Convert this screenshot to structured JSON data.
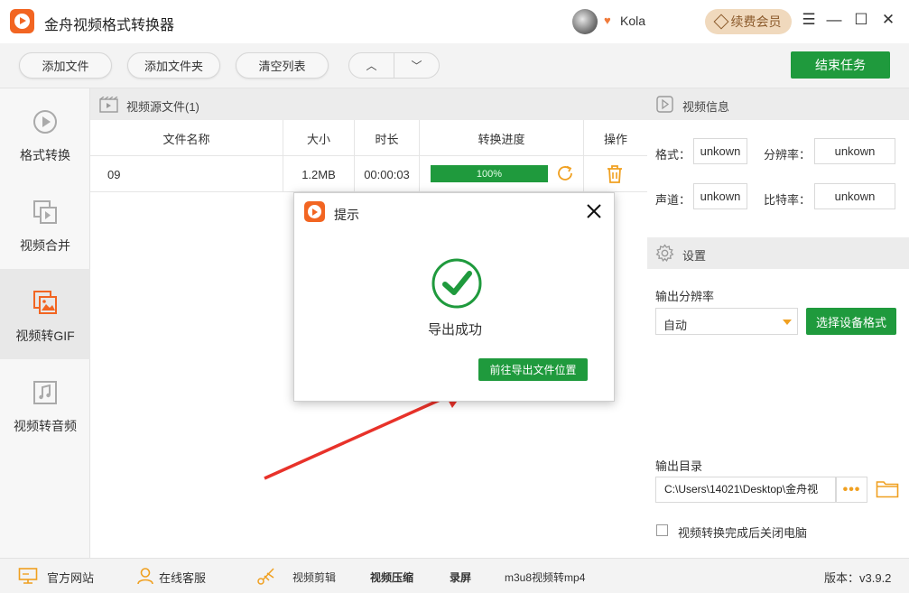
{
  "app": {
    "title": "金舟视频格式转换器",
    "username": "Kola",
    "vip_label": "续费会员"
  },
  "window_controls": [
    "☰",
    "—",
    "☐",
    "✕"
  ],
  "toolbar": {
    "add_file": "添加文件",
    "add_folder": "添加文件夹",
    "clear_list": "清空列表",
    "move_up": "︿",
    "move_down": "﹀",
    "end_task": "结束任务"
  },
  "sidebar": {
    "items": [
      {
        "label": "格式转换",
        "icon": "convert-icon",
        "active": false
      },
      {
        "label": "视频合并",
        "icon": "merge-icon",
        "active": false
      },
      {
        "label": "视频转GIF",
        "icon": "gif-icon",
        "active": true
      },
      {
        "label": "视频转音频",
        "icon": "audio-icon",
        "active": false
      }
    ]
  },
  "file_list": {
    "title": "视频源文件(1)",
    "columns": [
      "文件名称",
      "大小",
      "时长",
      "转换进度",
      "操作"
    ],
    "rows": [
      {
        "name": "09",
        "size": "1.2MB",
        "duration": "00:00:03",
        "progress_label": "100%",
        "progress": 1.0
      }
    ]
  },
  "video_info": {
    "title": "视频信息",
    "format_label": "格式：",
    "format_value": "unkown",
    "resolution_label": "分辨率：",
    "resolution_value": "unkown",
    "audio_label": "声道：",
    "audio_value": "unkown",
    "bitrate_label": "比特率：",
    "bitrate_value": "unkown"
  },
  "settings": {
    "title": "设置",
    "output_resolution_label": "输出分辨率",
    "output_resolution_value": "自动",
    "device_format_button": "选择设备格式",
    "output_dir_label": "输出目录",
    "output_dir_value": "C:\\Users\\14021\\Desktop\\金舟视",
    "dots": "•••",
    "shutdown_label": "视频转换完成后关闭电脑",
    "shutdown_checked": false
  },
  "footer": {
    "official_site": "官方网站",
    "online_service": "在线客服",
    "video_edit": "视频剪辑",
    "video_compress": "视频压缩",
    "screen_record": "录屏",
    "m3u8": "m3u8视频转mp4",
    "version": "版本：v3.9.2"
  },
  "dialog": {
    "title": "提示",
    "message": "导出成功",
    "open_location_button": "前往导出文件位置"
  },
  "colors": {
    "accent_green": "#1f9a3d",
    "logo_orange": "#f26522",
    "vip_bg": "#f0d9bd",
    "arrow_red": "#e8322a"
  }
}
